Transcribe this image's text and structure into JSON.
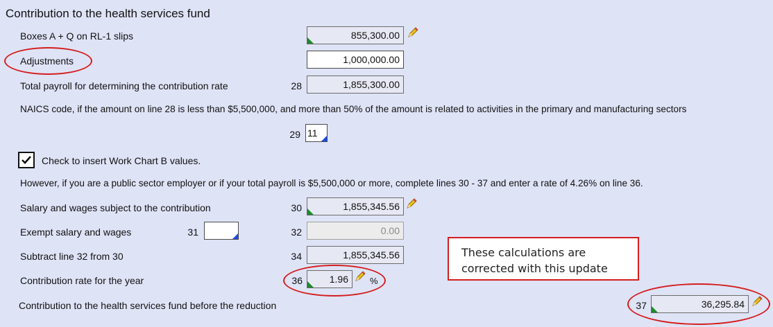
{
  "section_title": "Contribution to the health services fund",
  "rows": {
    "boxes": {
      "label": "Boxes A + Q on RL-1 slips",
      "value": "855,300.00"
    },
    "adjustments": {
      "label": "Adjustments",
      "value": "1,000,000.00"
    },
    "total_payroll": {
      "label": "Total payroll for determining the contribution rate",
      "line": "28",
      "value": "1,855,300.00"
    },
    "naics": {
      "label": "NAICS code, if the amount on line 28 is less than $5,500,000, and more than 50% of the amount is related to activities in the primary and manufacturing sectors",
      "line": "29",
      "value": "11"
    },
    "work_chart_b": {
      "label": "Check to insert Work Chart B values.",
      "checked": true
    },
    "public_sector_note": "However, if you are a public sector employer or if your total payroll is $5,500,000 or more, complete lines 30 - 37 and enter a rate of 4.26% on line 36.",
    "salary_subject": {
      "label": "Salary and wages subject to the contribution",
      "line": "30",
      "value": "1,855,345.56"
    },
    "exempt": {
      "label": "Exempt salary and wages",
      "line_a": "31",
      "value_a": "",
      "line_b": "32",
      "value_b": "0.00"
    },
    "subtract": {
      "label": "Subtract line 32 from 30",
      "line": "34",
      "value": "1,855,345.56"
    },
    "rate": {
      "label": "Contribution rate for the year",
      "line": "36",
      "value": "1.96",
      "unit": "%"
    },
    "before_reduction": {
      "label": "Contribution to the health services fund before the reduction",
      "line": "37",
      "value": "36,295.84"
    }
  },
  "annotation_note": {
    "line1": "These calculations are",
    "line2": "corrected with this update"
  },
  "colors": {
    "background": "#dfe3f6",
    "annotation_red": "#d41d1d",
    "entered_marker": "#1b8a2a",
    "input_marker": "#1d4ae0"
  },
  "icons": {
    "override": "pencil-icon",
    "checkbox": "checkmark-icon"
  }
}
